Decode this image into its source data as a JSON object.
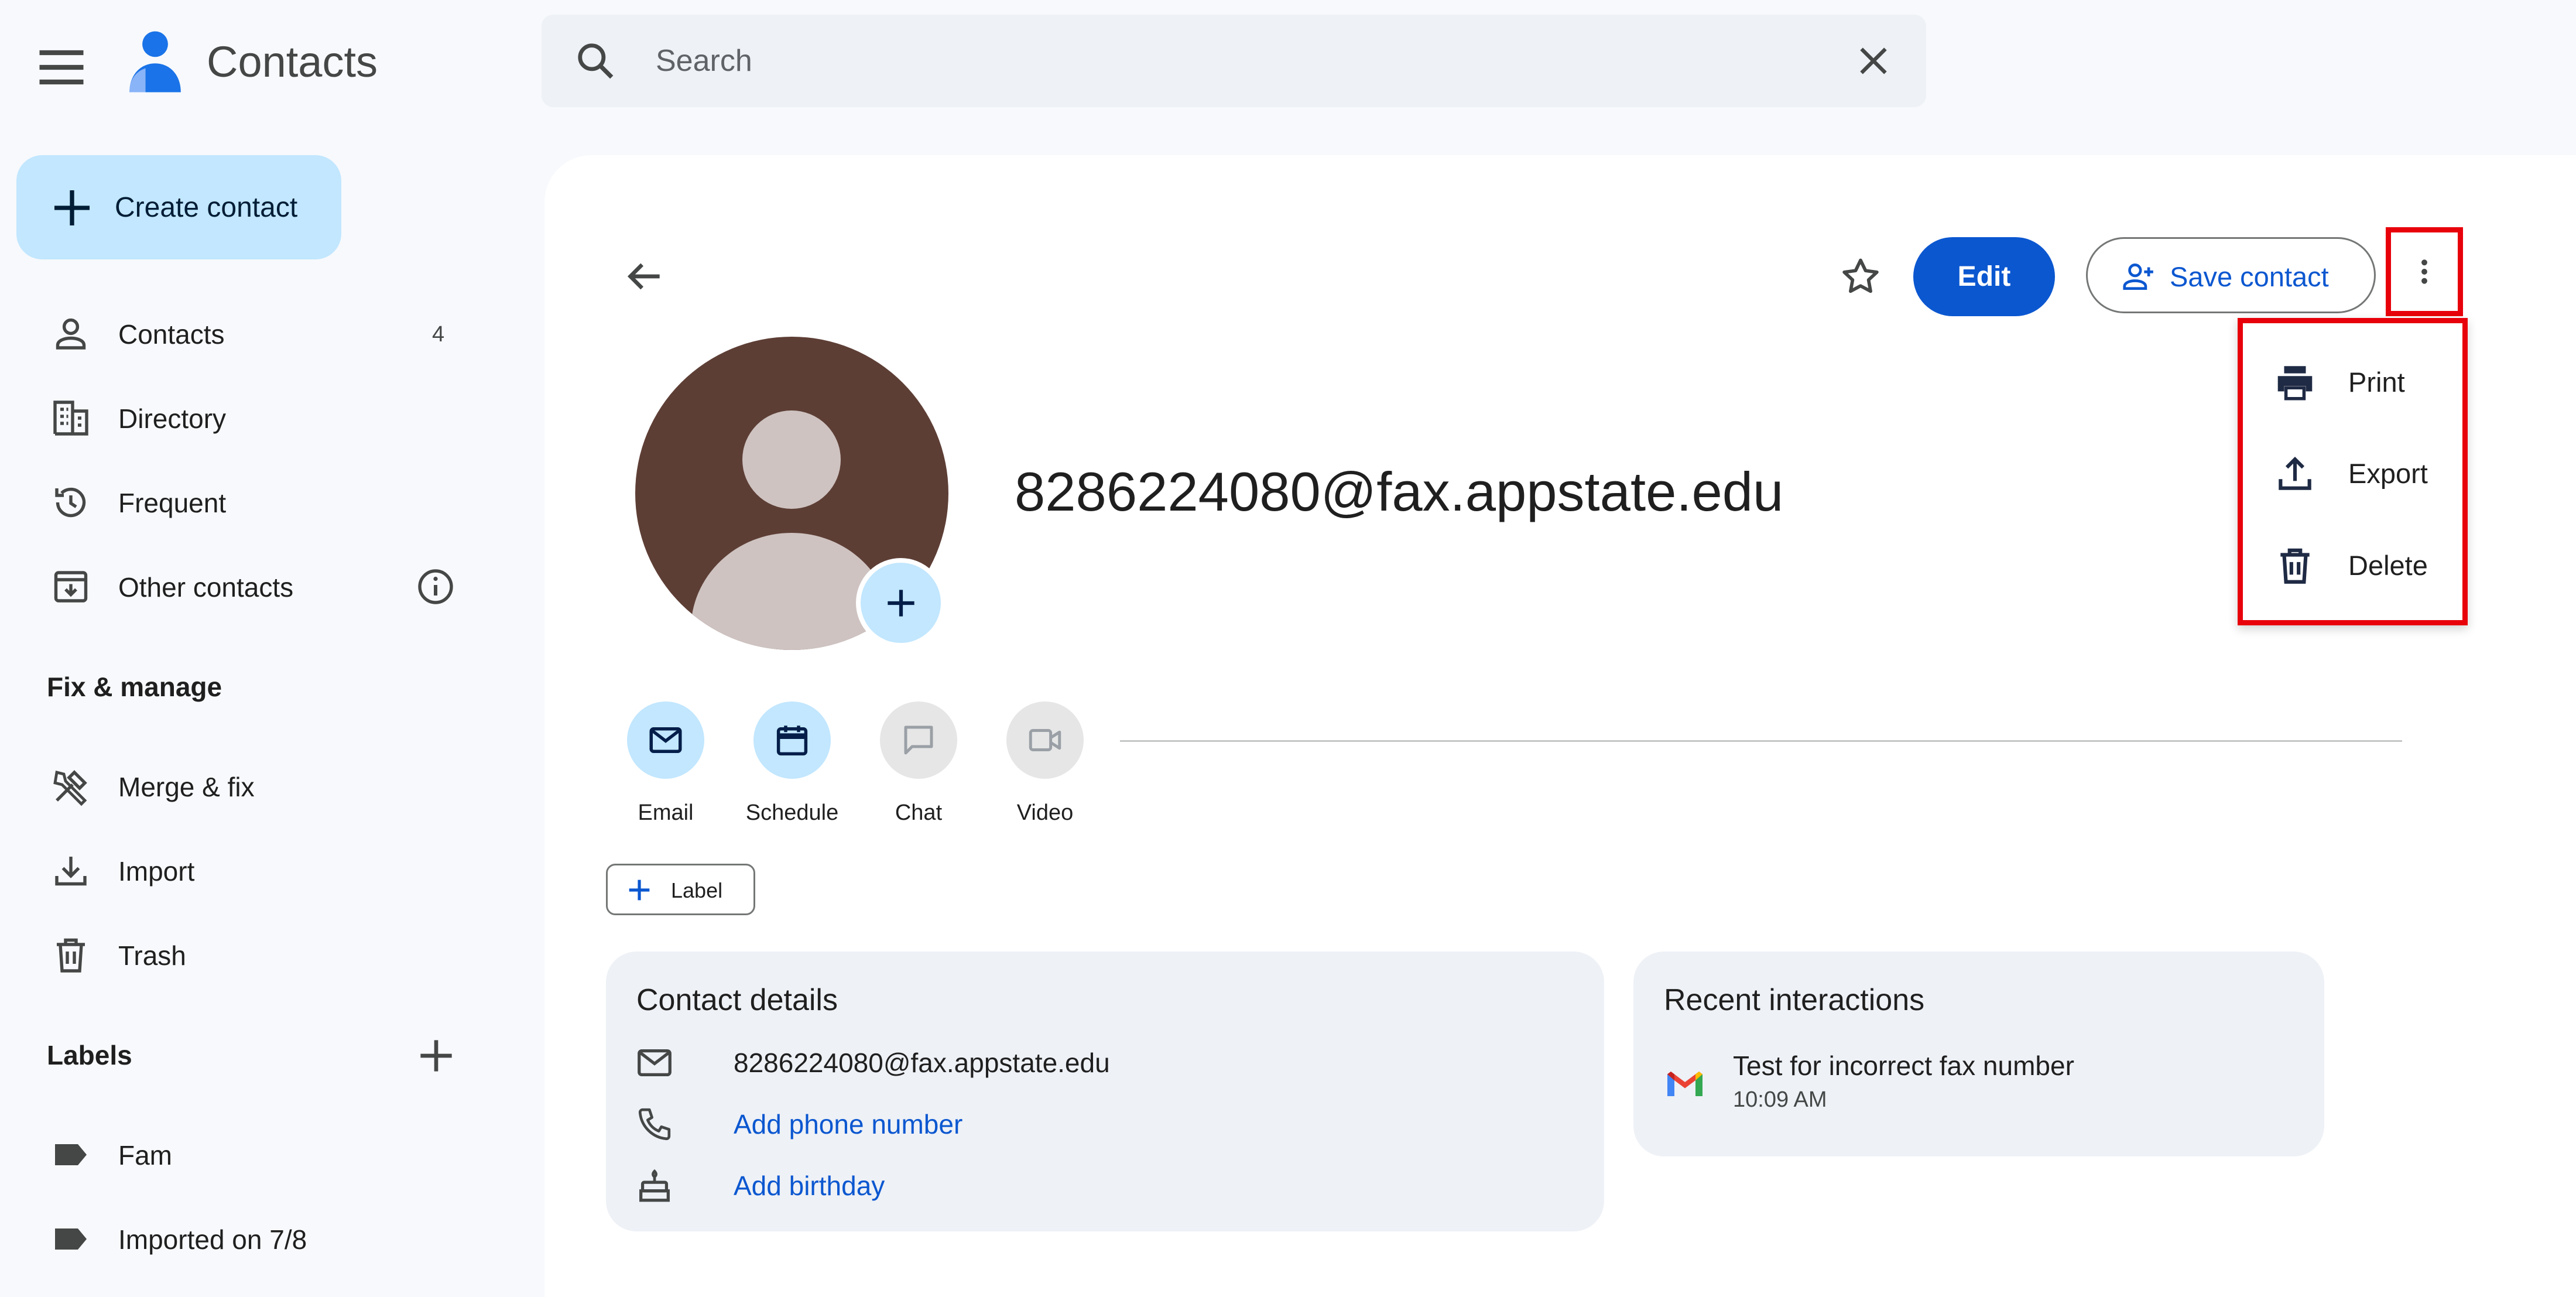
{
  "app": {
    "title": "Contacts",
    "search_placeholder": "Search"
  },
  "sidebar": {
    "create_label": "Create contact",
    "items": [
      {
        "label": "Contacts",
        "count": "4",
        "icon": "person-icon"
      },
      {
        "label": "Directory",
        "icon": "building-icon"
      },
      {
        "label": "Frequent",
        "icon": "history-icon"
      },
      {
        "label": "Other contacts",
        "icon": "archive-download-icon"
      }
    ],
    "fix_manage_heading": "Fix & manage",
    "fix_items": [
      {
        "label": "Merge & fix",
        "icon": "tools-icon"
      },
      {
        "label": "Import",
        "icon": "download-icon"
      },
      {
        "label": "Trash",
        "icon": "trash-icon"
      }
    ],
    "labels_heading": "Labels",
    "labels": [
      {
        "label": "Fam",
        "icon": "label-icon"
      },
      {
        "label": "Imported on 7/8",
        "icon": "label-icon"
      }
    ]
  },
  "toolbar": {
    "edit_label": "Edit",
    "save_label": "Save contact"
  },
  "menu": {
    "items": [
      {
        "label": "Print",
        "icon": "print-icon"
      },
      {
        "label": "Export",
        "icon": "export-icon"
      },
      {
        "label": "Delete",
        "icon": "delete-icon"
      }
    ]
  },
  "contact": {
    "name": "8286224080@fax.appstate.edu"
  },
  "actions": [
    {
      "label": "Email",
      "icon": "email-icon"
    },
    {
      "label": "Schedule",
      "icon": "calendar-icon"
    },
    {
      "label": "Chat",
      "icon": "chat-icon"
    },
    {
      "label": "Video",
      "icon": "video-icon"
    }
  ],
  "label_button": "Label",
  "details": {
    "title": "Contact details",
    "email": "8286224080@fax.appstate.edu",
    "add_phone": "Add phone number",
    "add_birthday": "Add birthday"
  },
  "recent": {
    "title": "Recent interactions",
    "item_title": "Test for incorrect fax number",
    "item_time": "10:09 AM"
  },
  "colors": {
    "accent": "#0b57d0",
    "highlight": "#e8000b",
    "avatar_bg": "#5d3e35",
    "chip_bg": "#c2e7ff"
  }
}
